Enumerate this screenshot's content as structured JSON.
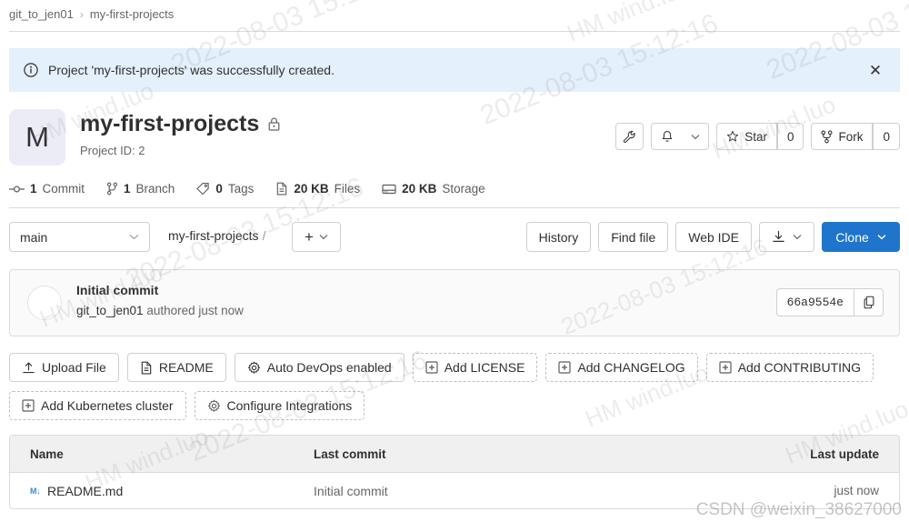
{
  "breadcrumb": {
    "group": "git_to_jen01",
    "separator": "›",
    "project": "my-first-projects"
  },
  "alert": {
    "icon": "info-circle-icon",
    "message": "Project 'my-first-projects' was successfully created.",
    "close_label": "✕",
    "background": "#e4f0fb"
  },
  "project": {
    "avatar_initial": "M",
    "avatar_color": "#ececf7",
    "name": "my-first-projects",
    "visibility_icon": "lock-icon",
    "id_label": "Project ID: 2",
    "actions": {
      "settings_icon": "wrench-icon",
      "notifications_icon": "bell-icon",
      "notifications_caret": "chevron-down-icon",
      "star_label": "Star",
      "star_icon": "star-icon",
      "star_count": "0",
      "fork_label": "Fork",
      "fork_icon": "fork-icon",
      "fork_count": "0"
    }
  },
  "stats": [
    {
      "icon": "commit-icon",
      "value": "1",
      "label": "Commit"
    },
    {
      "icon": "branch-icon",
      "value": "1",
      "label": "Branch"
    },
    {
      "icon": "tag-icon",
      "value": "0",
      "label": "Tags"
    },
    {
      "icon": "file-icon",
      "value": "20 KB",
      "label": "Files"
    },
    {
      "icon": "storage-icon",
      "value": "20 KB",
      "label": "Storage"
    }
  ],
  "refrow": {
    "branch_value": "main",
    "branch_caret": "chevron-down-icon",
    "path": "my-first-projects",
    "path_slash": "/",
    "plus_label": "+",
    "plus_caret": "chevron-down-icon",
    "history_label": "History",
    "find_file_label": "Find file",
    "web_ide_label": "Web IDE",
    "download_icon": "download-icon",
    "download_caret": "chevron-down-icon",
    "clone_label": "Clone",
    "clone_caret": "chevron-down-icon",
    "clone_color": "#1f75cb"
  },
  "last_commit": {
    "title": "Initial commit",
    "author": "git_to_jen01",
    "meta": " authored just now",
    "sha": "66a9554e",
    "copy_icon": "copy-icon"
  },
  "quick_actions": [
    {
      "icon": "upload-icon",
      "label": "Upload File",
      "dashed": false
    },
    {
      "icon": "file-icon",
      "label": "README",
      "dashed": false
    },
    {
      "icon": "gear-icon",
      "label": "Auto DevOps enabled",
      "dashed": false
    },
    {
      "icon": "plus-square-icon",
      "label": "Add LICENSE",
      "dashed": true
    },
    {
      "icon": "plus-square-icon",
      "label": "Add CHANGELOG",
      "dashed": true
    },
    {
      "icon": "plus-square-icon",
      "label": "Add CONTRIBUTING",
      "dashed": true
    }
  ],
  "quick_actions_row2": [
    {
      "icon": "plus-square-icon",
      "label": "Add Kubernetes cluster",
      "dashed": true
    },
    {
      "icon": "gear-icon",
      "label": "Configure Integrations",
      "dashed": true
    }
  ],
  "file_table": {
    "columns": {
      "name": "Name",
      "last_commit": "Last commit",
      "last_update": "Last update"
    },
    "rows": [
      {
        "icon": "markdown-icon",
        "icon_text": "M↓",
        "name": "README.md",
        "last_commit": "Initial commit",
        "last_update": "just now"
      }
    ]
  },
  "watermarks": {
    "csdn": "CSDN @weixin_38627000",
    "tiles": [
      "2022-08-03  15:12:16",
      "HM wind.luo",
      "2022-08-03  15:12:16",
      "HM wind.luo"
    ]
  }
}
